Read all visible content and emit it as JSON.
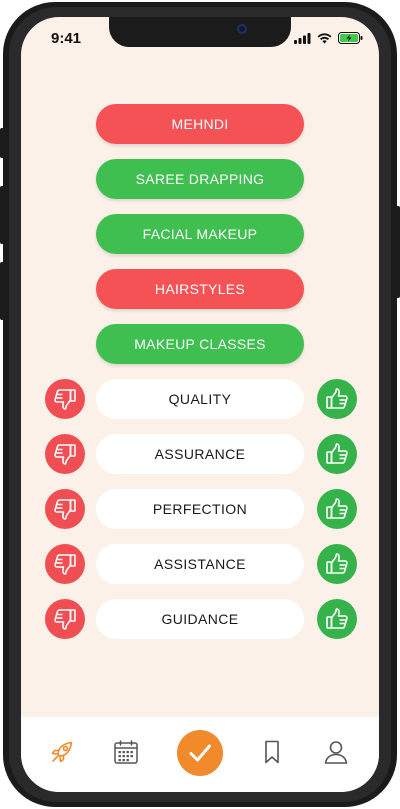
{
  "status_bar": {
    "time": "9:41"
  },
  "services": [
    {
      "label": "MEHNDI",
      "status": "red"
    },
    {
      "label": "SAREE DRAPPING",
      "status": "green"
    },
    {
      "label": "FACIAL MAKEUP",
      "status": "green"
    },
    {
      "label": "HAIRSTYLES",
      "status": "red"
    },
    {
      "label": "MAKEUP CLASSES",
      "status": "green"
    }
  ],
  "ratings": [
    {
      "label": "QUALITY"
    },
    {
      "label": "ASSURANCE"
    },
    {
      "label": "PERFECTION"
    },
    {
      "label": "ASSISTANCE"
    },
    {
      "label": "GUIDANCE"
    }
  ],
  "icons": {
    "dislike": "thumbs-down-icon",
    "like": "thumbs-up-icon",
    "tabs": [
      "rocket-icon",
      "calendar-icon",
      "check-icon",
      "bookmark-icon",
      "user-icon"
    ]
  },
  "colors": {
    "red": "#f55255",
    "green": "#3fbf50",
    "accent": "#f08a2a",
    "background": "#fbf1e8"
  }
}
